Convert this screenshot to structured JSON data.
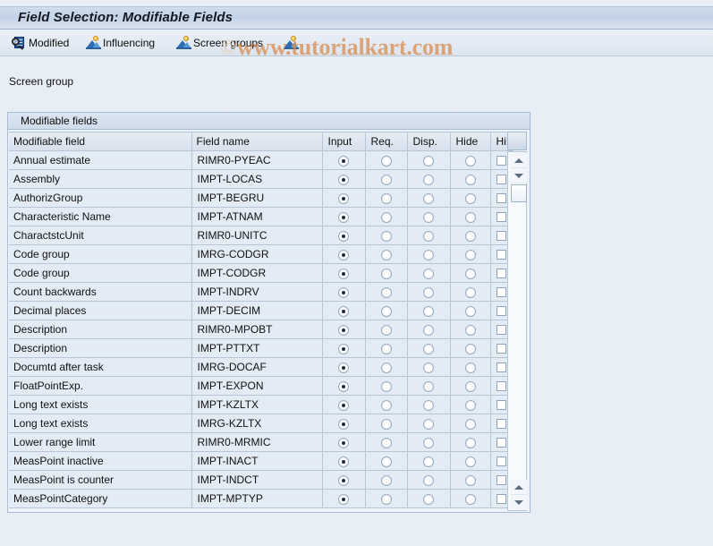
{
  "window": {
    "title": "Field Selection: Modifiable Fields"
  },
  "toolbar": {
    "buttons": [
      {
        "label": "Modified",
        "icon": "magnifier-document-icon"
      },
      {
        "label": "Influencing",
        "icon": "mountain-picture-icon"
      },
      {
        "label": "Screen groups",
        "icon": "mountain-picture-icon"
      },
      {
        "label": "",
        "icon": "mountain-picture-icon"
      }
    ]
  },
  "watermark": {
    "copyright": "©",
    "text": "www.tutorialkart.com"
  },
  "screen_group": {
    "label": "Screen group"
  },
  "panel": {
    "header": "Modifiable fields"
  },
  "table": {
    "columns": [
      "Modifiable field",
      "Field name",
      "Input",
      "Req.",
      "Disp.",
      "Hide",
      "HiLi"
    ],
    "rows": [
      {
        "field": "Annual estimate",
        "name": "RIMR0-PYEAC",
        "selected": "Input",
        "hili": false
      },
      {
        "field": "Assembly",
        "name": "IMPT-LOCAS",
        "selected": "Input",
        "hili": false
      },
      {
        "field": "AuthorizGroup",
        "name": "IMPT-BEGRU",
        "selected": "Input",
        "hili": false
      },
      {
        "field": "Characteristic Name",
        "name": "IMPT-ATNAM",
        "selected": "Input",
        "hili": false
      },
      {
        "field": "CharactstcUnit",
        "name": "RIMR0-UNITC",
        "selected": "Input",
        "hili": false
      },
      {
        "field": "Code group",
        "name": "IMRG-CODGR",
        "selected": "Input",
        "hili": false
      },
      {
        "field": "Code group",
        "name": "IMPT-CODGR",
        "selected": "Input",
        "hili": false
      },
      {
        "field": "Count backwards",
        "name": "IMPT-INDRV",
        "selected": "Input",
        "hili": false
      },
      {
        "field": "Decimal places",
        "name": "IMPT-DECIM",
        "selected": "Input",
        "hili": false
      },
      {
        "field": "Description",
        "name": "RIMR0-MPOBT",
        "selected": "Input",
        "hili": false
      },
      {
        "field": "Description",
        "name": "IMPT-PTTXT",
        "selected": "Input",
        "hili": false
      },
      {
        "field": "Documtd after task",
        "name": "IMRG-DOCAF",
        "selected": "Input",
        "hili": false
      },
      {
        "field": "FloatPointExp.",
        "name": "IMPT-EXPON",
        "selected": "Input",
        "hili": false
      },
      {
        "field": "Long text exists",
        "name": "IMPT-KZLTX",
        "selected": "Input",
        "hili": false
      },
      {
        "field": "Long text exists",
        "name": "IMRG-KZLTX",
        "selected": "Input",
        "hili": false
      },
      {
        "field": "Lower range limit",
        "name": "RIMR0-MRMIC",
        "selected": "Input",
        "hili": false
      },
      {
        "field": "MeasPoint inactive",
        "name": "IMPT-INACT",
        "selected": "Input",
        "hili": false
      },
      {
        "field": "MeasPoint is counter",
        "name": "IMPT-INDCT",
        "selected": "Input",
        "hili": false
      },
      {
        "field": "MeasPointCategory",
        "name": "IMPT-MPTYP",
        "selected": "Input",
        "hili": false
      }
    ]
  },
  "colors": {
    "page_background": "#e8eef6",
    "title_bar": "#c3d3e6",
    "row_background": "#e3ebf5",
    "grid_line": "#b6c6d8",
    "watermark": "#d98a4a",
    "radio_dot": "#1b2a45"
  }
}
